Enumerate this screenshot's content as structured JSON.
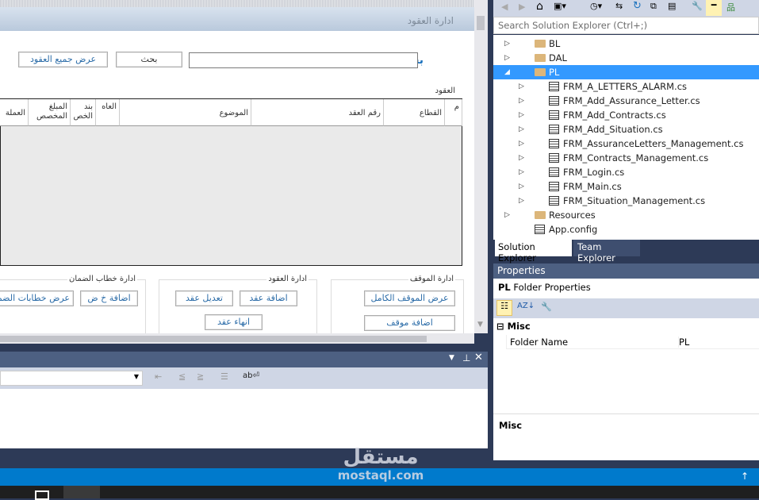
{
  "document_tab": {
    "title": "ادارة العقود"
  },
  "search": {
    "label": "بحث",
    "input_value": "",
    "search_button": "بحث",
    "show_all_button": "عرض جميع العقود"
  },
  "contracts_group": {
    "title": "العقود",
    "columns": [
      "م",
      "القطاع",
      "رقم العقد",
      "الموضوع",
      "العاه",
      "بند الخص",
      "المبلغ المخصص",
      "العملة"
    ]
  },
  "groups": {
    "position": {
      "title": "ادارة الموقف",
      "buttons": [
        "عرض الموقف الكامل",
        "اضافة موقف"
      ]
    },
    "contracts": {
      "title": "ادارة العقود",
      "buttons": [
        "اضافة عقد",
        "تعديل عقد",
        "انهاء عقد"
      ]
    },
    "guarantee": {
      "title": "ادارة خطاب الضمان",
      "buttons": [
        "اضافة خ ض",
        "عرض خطابات الضمان"
      ]
    }
  },
  "solution_explorer": {
    "search_placeholder": "Search Solution Explorer (Ctrl+;)",
    "items": [
      {
        "label": "BL",
        "type": "folder"
      },
      {
        "label": "DAL",
        "type": "folder"
      },
      {
        "label": "PL",
        "type": "folder",
        "selected": true
      },
      {
        "label": "FRM_A_LETTERS_ALARM.cs",
        "type": "file"
      },
      {
        "label": "FRM_Add_Assurance_Letter.cs",
        "type": "file"
      },
      {
        "label": "FRM_Add_Contracts.cs",
        "type": "file"
      },
      {
        "label": "FRM_Add_Situation.cs",
        "type": "file"
      },
      {
        "label": "FRM_AssuranceLetters_Management.cs",
        "type": "file"
      },
      {
        "label": "FRM_Contracts_Management.cs",
        "type": "file"
      },
      {
        "label": "FRM_Login.cs",
        "type": "file"
      },
      {
        "label": "FRM_Main.cs",
        "type": "file"
      },
      {
        "label": "FRM_Situation_Management.cs",
        "type": "file"
      },
      {
        "label": "Resources",
        "type": "folder"
      },
      {
        "label": "App.config",
        "type": "config"
      }
    ],
    "tabs": [
      "Solution Explorer",
      "Team Explorer"
    ]
  },
  "properties": {
    "title": "Properties",
    "object": "PL",
    "object_type": "Folder Properties",
    "category": "Misc",
    "rows": [
      {
        "name": "Folder Name",
        "value": "PL"
      }
    ],
    "description_title": "Misc"
  },
  "watermark": {
    "arabic": "مستقل",
    "latin": "mostaql.com"
  },
  "colors": {
    "accent": "#007acc",
    "selection": "#3399ff",
    "panel_header": "#4d6082"
  }
}
